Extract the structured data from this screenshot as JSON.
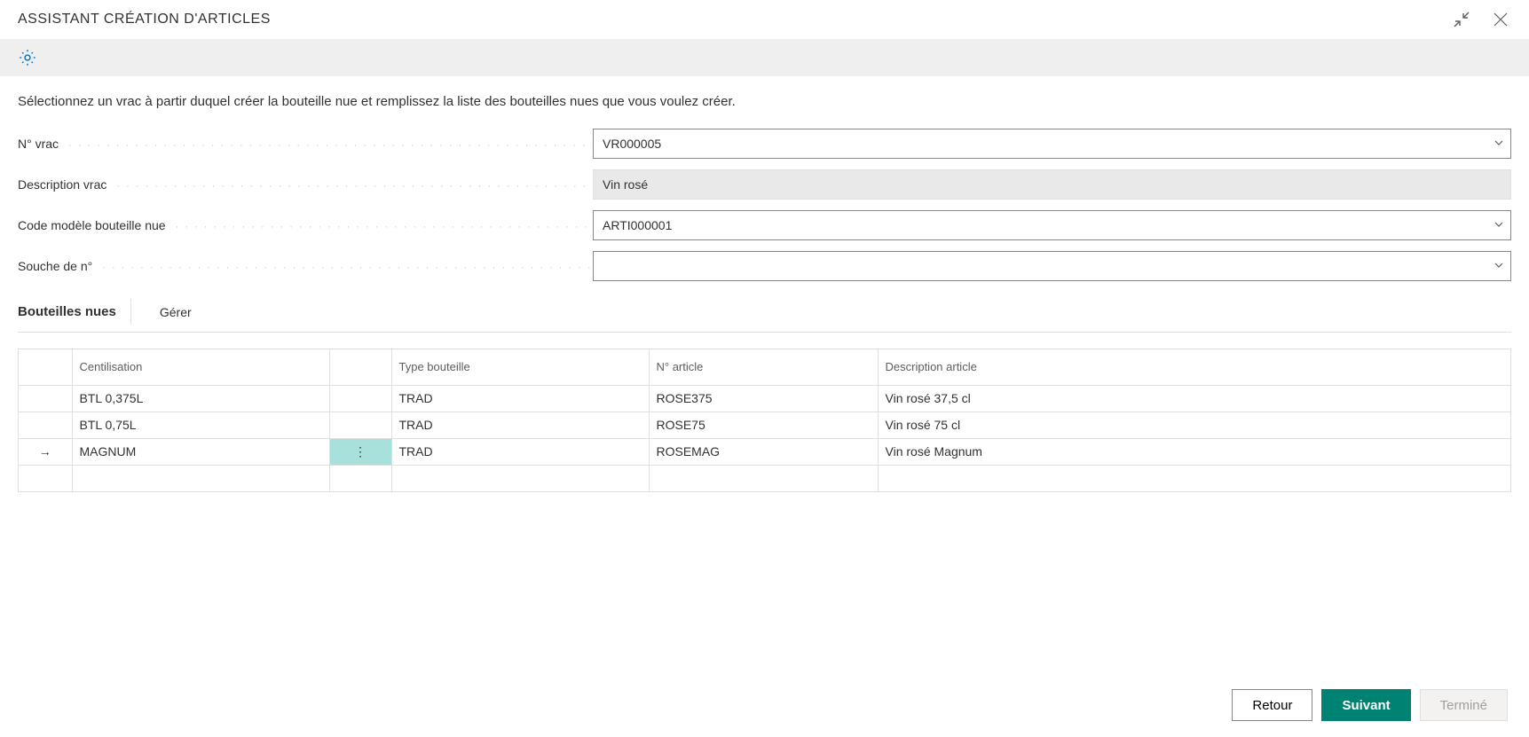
{
  "header": {
    "title": "ASSISTANT CRÉATION D'ARTICLES"
  },
  "intro": "Sélectionnez un vrac à partir duquel créer la bouteille nue et remplissez la liste des bouteilles nues que vous voulez créer.",
  "form": {
    "vrac_no_label": "N° vrac",
    "vrac_no_value": "VR000005",
    "vrac_desc_label": "Description vrac",
    "vrac_desc_value": "Vin rosé",
    "model_code_label": "Code modèle bouteille nue",
    "model_code_value": "ARTI000001",
    "souche_label": "Souche de n°",
    "souche_value": ""
  },
  "section": {
    "title": "Bouteilles nues",
    "manage": "Gérer",
    "columns": {
      "cent": "Centilisation",
      "type": "Type bouteille",
      "article": "N° article",
      "desc": "Description article"
    },
    "rows": [
      {
        "indicator": "",
        "cent": "BTL 0,375L",
        "type": "TRAD",
        "article": "ROSE375",
        "desc": "Vin rosé 37,5 cl",
        "active": false
      },
      {
        "indicator": "",
        "cent": "BTL 0,75L",
        "type": "TRAD",
        "article": "ROSE75",
        "desc": "Vin rosé 75 cl",
        "active": false
      },
      {
        "indicator": "→",
        "cent": "MAGNUM",
        "type": "TRAD",
        "article": "ROSEMAG",
        "desc": "Vin rosé Magnum",
        "active": true
      },
      {
        "indicator": "",
        "cent": "",
        "type": "",
        "article": "",
        "desc": "",
        "active": false
      }
    ]
  },
  "footer": {
    "back": "Retour",
    "next": "Suivant",
    "finish": "Terminé"
  }
}
